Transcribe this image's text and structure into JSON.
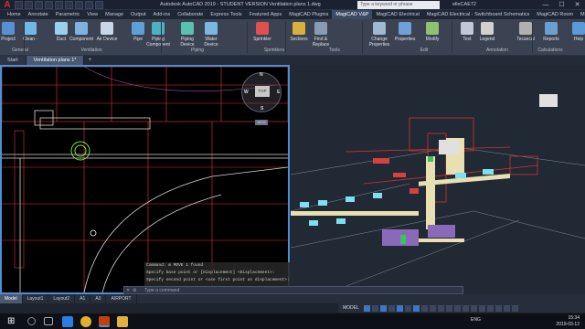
{
  "app": {
    "logo": "A",
    "title": "Autodesk AutoCAD 2019 - STUDENT VERSION    Ventilation plans 1.dwg",
    "search_placeholder": "Type a keyword or phrase",
    "user": "elleCAE72",
    "minimize": "—",
    "maximize": "☐",
    "close": "✕"
  },
  "ribbon_tabs": [
    "Home",
    "Annotate",
    "Parametric",
    "View",
    "Manage",
    "Output",
    "Add-ins",
    "Collaborate",
    "Express Tools",
    "Featured Apps",
    "MagiCAD Plugins",
    "MagiCAD V&P",
    "MagiCAD Electrical",
    "MagiCAD Electrical - Switchboard Schematics",
    "MagiCAD Room",
    "MagiCAD Co"
  ],
  "ribbon_active_tab": 11,
  "ribbon": {
    "buttons": [
      "Project",
      "Clean -",
      "Duct",
      "Component",
      "Air Device",
      "Pipe",
      "Piping Component",
      "Piping Device",
      "Water Device",
      "Sprinkler",
      "Sections",
      "Find & Replace",
      "Change Properties",
      "Properties",
      "Modify",
      "Text",
      "Legend",
      "Tecsecal",
      "Reports",
      "Help"
    ],
    "groups": [
      "General",
      "Ventilation",
      "Piping",
      "Sprinklers",
      "Tools",
      "Edit",
      "Annotation",
      "Calculations"
    ]
  },
  "doc_tabs": [
    "Start",
    "Ventilation plans 1*"
  ],
  "viewcube": {
    "top": "TOP",
    "north": "N",
    "south": "S",
    "east": "E",
    "west": "W",
    "wcs": "WCS"
  },
  "command": {
    "history": [
      "Command: m MOVE 1 found",
      "Specify base point or [Displacement] <Displacement>:",
      "Specify second point or <use first point as displacement>:"
    ],
    "placeholder": "Type a command"
  },
  "layout_tabs": [
    "Model",
    "Layout1",
    "Layout2",
    "A1",
    "A3",
    "AIRPORT"
  ],
  "status": {
    "model": "MODEL"
  },
  "taskbar": {
    "time": "15:34",
    "date": "2019-03-12",
    "lang": "ENG"
  },
  "colors": {
    "accent": "#4a8fd8",
    "viewport_bg": "#000000",
    "right_bg": "#212935",
    "duct": "#e8e0b0",
    "pipe": "#e03b3b"
  }
}
